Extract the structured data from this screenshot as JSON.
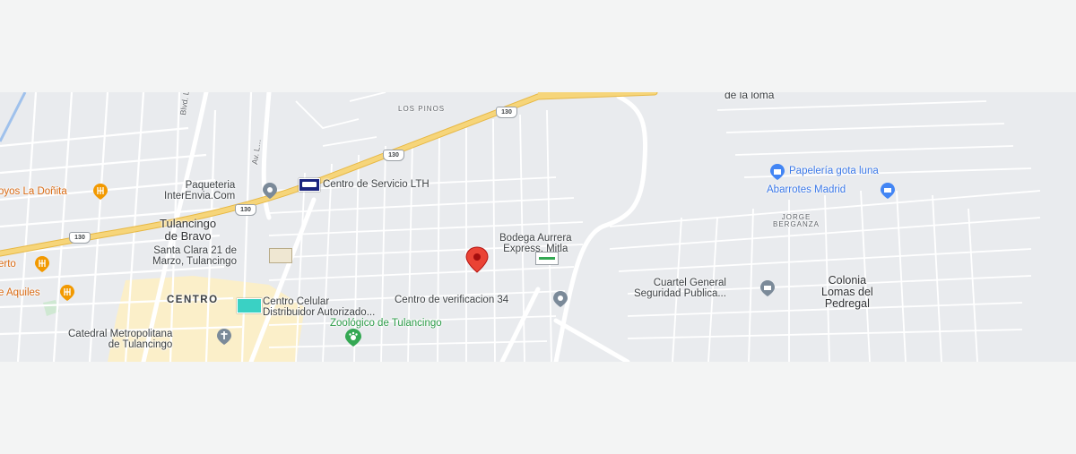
{
  "map": {
    "places": {
      "los_pinos": "LOS PINOS",
      "de_la_loma": "de la loma",
      "tulancingo": "Tulancingo\nde Bravo",
      "centro": "CENTRO",
      "jorge_berganza": "JORGE\nBERGANZA",
      "colonia_lomas": "Colonia\nLomas del\nPedregal"
    },
    "roads": {
      "blvd_la_morena": "Blvd. La Morena",
      "av_street": "Av. L…",
      "route_130_a": "130",
      "route_130_b": "130",
      "route_130_c": "130",
      "route_130_d": "130"
    },
    "pois": {
      "paqueteria": "Paqueteria\nInterEnvia.Com",
      "centro_servicio": "Centro de Servicio LTH",
      "bodega": "Bodega Aurrera\nExpress, Mitla",
      "santa_clara": "Santa Clara 21 de\nMarzo, Tulancingo",
      "centro_celular": "Centro Celular\nDistribuidor Autorizado...",
      "centro_verificacion": "Centro de verificacion 34",
      "zoologico": "Zoológico de Tulancingo",
      "catedral": "Catedral Metropolitana\nde Tulancingo",
      "papeleria": "Papelería gota luna",
      "abarrotes": "Abarrotes Madrid",
      "cuartel": "Cuartel General\nSeguridad Publica...",
      "pollos": "oyos La Doñita",
      "erto": "erto",
      "aquiles": "e Aquiles"
    },
    "colors": {
      "highway": "#f6d57a",
      "highway_edge": "#e7b844",
      "road": "#ffffff",
      "block": "#e9ebee",
      "centro_area": "#fbefc9",
      "pin": "#ea4335",
      "poi_blue": "#4285f4",
      "poi_orange": "#f29900",
      "poi_green": "#34a853",
      "poi_gray": "#7b8a99"
    }
  }
}
